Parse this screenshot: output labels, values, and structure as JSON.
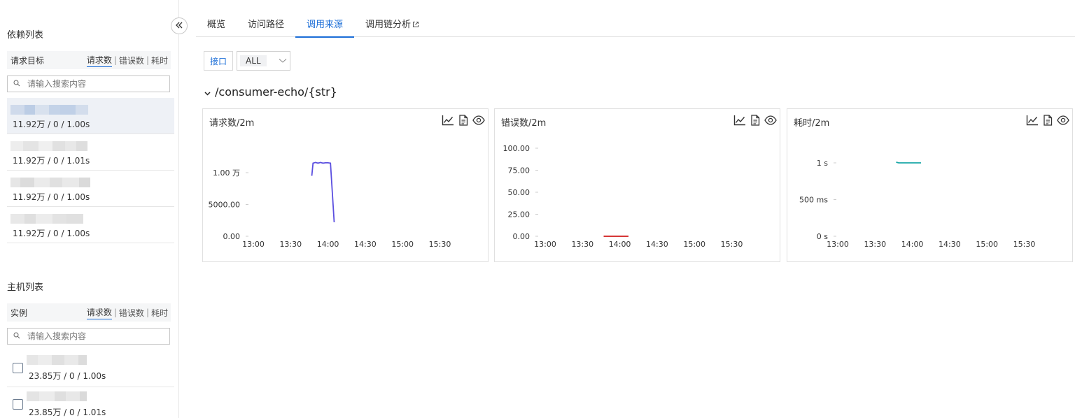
{
  "sidebar": {
    "dependency_title": "依赖列表",
    "dep_header": {
      "label": "请求目标",
      "sort": [
        "请求数",
        "错误数",
        "耗时"
      ],
      "sep": "|"
    },
    "dep_search_placeholder": "请输入搜索内容",
    "dependencies": [
      {
        "stats": "11.92万 / 0 / 1.00s"
      },
      {
        "stats": "11.92万 / 0 / 1.01s"
      },
      {
        "stats": "11.92万 / 0 / 1.00s"
      },
      {
        "stats": "11.92万 / 0 / 1.00s"
      }
    ],
    "host_title": "主机列表",
    "host_header": {
      "label": "实例",
      "sort": [
        "请求数",
        "错误数",
        "耗时"
      ],
      "sep": "|"
    },
    "host_search_placeholder": "请输入搜索内容",
    "hosts": [
      {
        "stats": "23.85万 / 0 / 1.00s"
      },
      {
        "stats": "23.85万 / 0 / 1.01s"
      }
    ]
  },
  "tabs": [
    "概览",
    "访问路径",
    "调用来源",
    "调用链分析"
  ],
  "active_tab": "调用来源",
  "filter": {
    "label": "接口",
    "value": "ALL"
  },
  "group_title": "/consumer-echo/{str}",
  "colors": {
    "accent": "#1a6dd7",
    "requests": "#5b4fe0",
    "errors": "#d11a1a",
    "latency": "#1aa7a7"
  },
  "chart_data": [
    {
      "type": "line",
      "title": "请求数/2m",
      "x_ticks": [
        "13:00",
        "13:30",
        "14:00",
        "14:30",
        "15:00",
        "15:30"
      ],
      "y_ticks": [
        "0.00",
        "5000.00",
        "1.00 万"
      ],
      "ylim": [
        0,
        10000
      ],
      "series": [
        {
          "x": [
            "13:47",
            "13:48",
            "13:50",
            "13:52",
            "13:54",
            "13:56",
            "13:58",
            "14:00",
            "14:02",
            "14:05"
          ],
          "values": [
            9500,
            11500,
            11600,
            11500,
            11600,
            11500,
            11550,
            11550,
            11500,
            2200
          ]
        }
      ]
    },
    {
      "type": "line",
      "title": "错误数/2m",
      "x_ticks": [
        "13:00",
        "13:30",
        "14:00",
        "14:30",
        "15:00",
        "15:30"
      ],
      "y_ticks": [
        "0.00",
        "25.00",
        "50.00",
        "75.00",
        "100.00"
      ],
      "ylim": [
        0,
        100
      ],
      "series": [
        {
          "x": [
            "13:47",
            "14:07"
          ],
          "values": [
            0,
            0
          ]
        }
      ]
    },
    {
      "type": "line",
      "title": "耗时/2m",
      "x_ticks": [
        "13:00",
        "13:30",
        "14:00",
        "14:30",
        "15:00",
        "15:30"
      ],
      "y_ticks": [
        "0 s",
        "500 ms",
        "1 s"
      ],
      "ylim": [
        0,
        1000
      ],
      "series": [
        {
          "x": [
            "13:47",
            "13:49",
            "14:07"
          ],
          "values": [
            1010,
            1000,
            1000
          ]
        }
      ]
    }
  ]
}
